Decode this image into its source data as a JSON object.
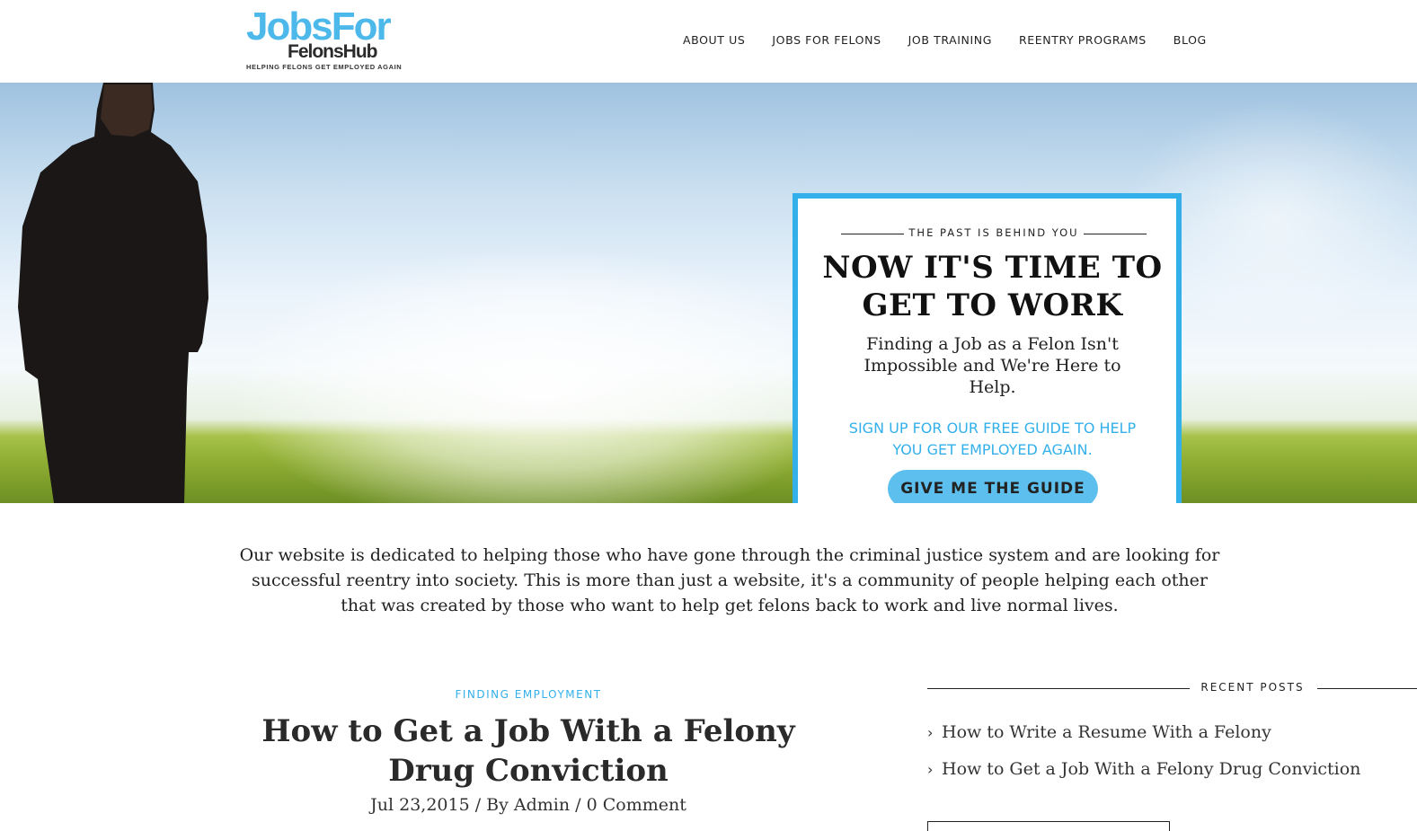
{
  "header": {
    "logo_main": "JobsFor",
    "logo_sub": "FelonsHub",
    "logo_tag": "HELPING FELONS GET EMPLOYED AGAIN",
    "nav": [
      {
        "label": "ABOUT US"
      },
      {
        "label": "JOBS FOR FELONS"
      },
      {
        "label": "JOB TRAINING"
      },
      {
        "label": "REENTRY PROGRAMS"
      },
      {
        "label": "BLOG"
      }
    ]
  },
  "hero": {
    "kicker": "THE PAST IS BEHIND YOU",
    "title": "NOW IT'S TIME TO GET TO WORK",
    "subtitle": "Finding a Job as a Felon Isn't Impossible and We're Here to Help.",
    "cta_text": "SIGN UP FOR OUR FREE GUIDE TO HELP YOU GET EMPLOYED AGAIN.",
    "button_label": "GIVE ME THE GUIDE"
  },
  "intro": {
    "text": "Our website is dedicated to helping those who have gone through the criminal justice system and are looking for successful reentry into society. This is more than just a website, it's a community of people helping each other that was created by those who want to help get felons back to work and live normal lives."
  },
  "post": {
    "category": "FINDING EMPLOYMENT",
    "title": "How to Get a Job With a Felony Drug Conviction",
    "meta": "Jul 23,2015 / By Admin / 0 Comment"
  },
  "sidebar": {
    "recent_heading": "RECENT POSTS",
    "recent_posts": [
      {
        "label": "How to Write a Resume With a Felony"
      },
      {
        "label": "How to Get a Job With a Felony Drug Conviction"
      }
    ]
  },
  "colors": {
    "accent": "#33b0ea",
    "button": "#5cbfee",
    "text": "#222222"
  }
}
